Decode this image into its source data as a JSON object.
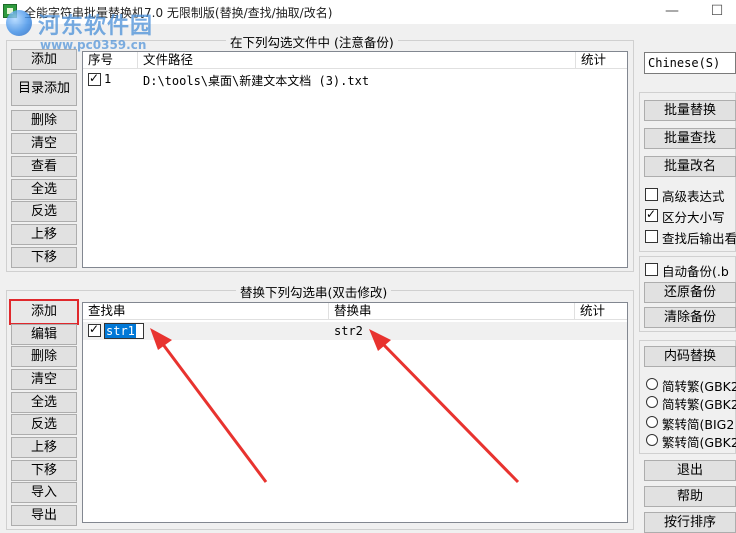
{
  "window": {
    "title": "全能字符串批量替换机7.0 无限制版(替换/查找/抽取/改名)",
    "minimize": "—",
    "maximize": "☐"
  },
  "watermark": {
    "site_name": "河东软件园",
    "url": "www.pc0359.cn"
  },
  "files_group": {
    "title": "在下列勾选文件中 (注意备份)",
    "buttons": [
      "添加",
      "目录添加",
      "删除",
      "清空",
      "查看",
      "全选",
      "反选",
      "上移",
      "下移"
    ],
    "columns": [
      "序号",
      "文件路径",
      "统计"
    ],
    "rows": [
      {
        "checked": true,
        "index": "1",
        "path": "D:\\tools\\桌面\\新建文本文档 (3).txt",
        "stat": ""
      }
    ]
  },
  "replace_group": {
    "title": "替换下列勾选串(双击修改)",
    "buttons": [
      "添加",
      "编辑",
      "删除",
      "清空",
      "全选",
      "反选",
      "上移",
      "下移",
      "导入",
      "导出"
    ],
    "columns": [
      "查找串",
      "替换串",
      "统计"
    ],
    "rows": [
      {
        "checked": true,
        "find": "str1",
        "replace": "str2",
        "stat": ""
      }
    ]
  },
  "right_panel": {
    "language": "Chinese(S)",
    "batch_buttons": [
      "批量替换",
      "批量查找",
      "批量改名"
    ],
    "options": [
      {
        "label": "高级表达式",
        "checked": false
      },
      {
        "label": "区分大小写",
        "checked": true
      },
      {
        "label": "查找后输出看",
        "checked": false
      }
    ],
    "auto_backup": {
      "label": "自动备份(.b",
      "checked": false
    },
    "backup_buttons": [
      "还原备份",
      "清除备份"
    ],
    "encoding_button": "内码替换",
    "encoding_options": [
      "简转繁(GBK2",
      "简转繁(GBK2",
      "繁转简(BIG2",
      "繁转简(GBK2"
    ],
    "bottom_buttons": [
      "退出",
      "帮助",
      "按行排序"
    ]
  },
  "colors": {
    "highlight_border": "#e0282c",
    "arrow": "#e8332f",
    "selection": "#0078d7"
  }
}
